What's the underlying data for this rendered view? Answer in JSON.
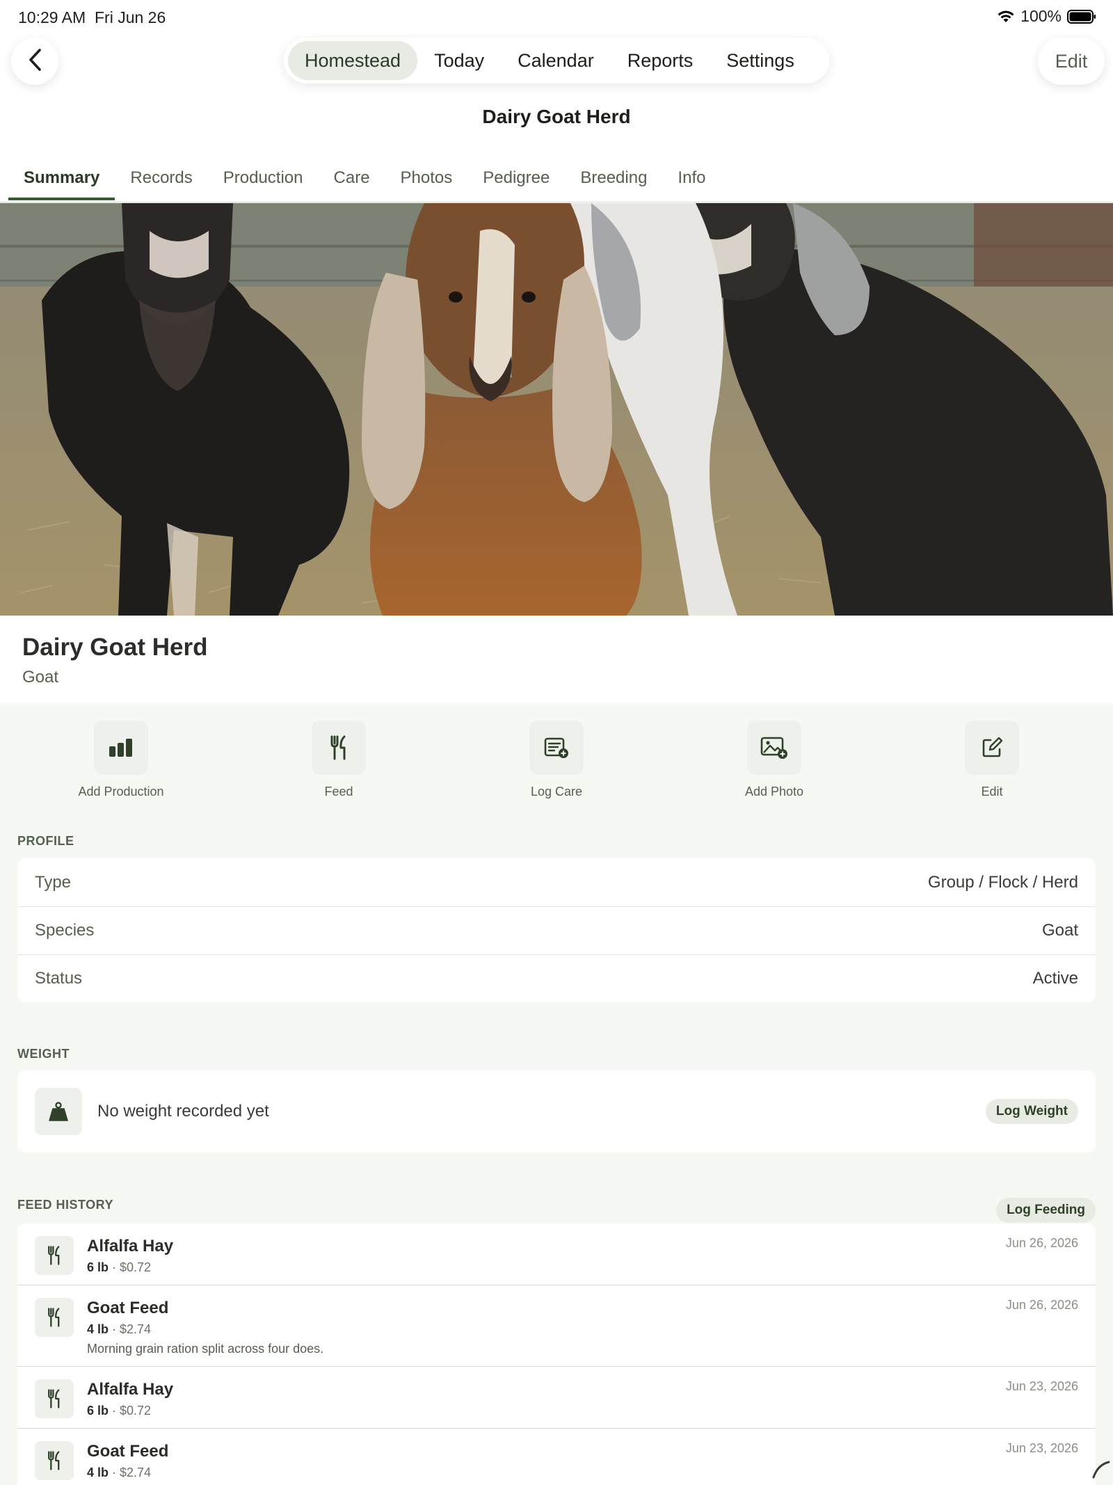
{
  "status_bar": {
    "time": "10:29 AM",
    "date": "Fri Jun 26",
    "battery": "100%",
    "icons": [
      "wifi-icon",
      "battery-icon"
    ]
  },
  "nav": {
    "items": [
      "Homestead",
      "Today",
      "Calendar",
      "Reports",
      "Settings"
    ],
    "active": "Homestead",
    "edit_label": "Edit"
  },
  "page": {
    "title": "Dairy Goat Herd"
  },
  "tabs": {
    "items": [
      "Summary",
      "Records",
      "Production",
      "Care",
      "Photos",
      "Pedigree",
      "Breeding",
      "Info"
    ],
    "active": "Summary"
  },
  "animal": {
    "name": "Dairy Goat Herd",
    "species": "Goat"
  },
  "actions": [
    {
      "label": "Add Production",
      "icon": "bar-chart-icon"
    },
    {
      "label": "Feed",
      "icon": "fork-knife-icon"
    },
    {
      "label": "Log Care",
      "icon": "care-list-icon"
    },
    {
      "label": "Add Photo",
      "icon": "add-photo-icon"
    },
    {
      "label": "Edit",
      "icon": "edit-icon"
    }
  ],
  "profile": {
    "header": "PROFILE",
    "rows": [
      {
        "key": "Type",
        "value": "Group / Flock / Herd"
      },
      {
        "key": "Species",
        "value": "Goat"
      },
      {
        "key": "Status",
        "value": "Active"
      }
    ]
  },
  "weight": {
    "header": "WEIGHT",
    "empty_text": "No weight recorded yet",
    "button": "Log Weight"
  },
  "feed_history": {
    "header": "FEED HISTORY",
    "button": "Log Feeding",
    "entries": [
      {
        "name": "Alfalfa Hay",
        "amount": "6 lb",
        "cost": "· $0.72",
        "date": "Jun 26, 2026",
        "note": ""
      },
      {
        "name": "Goat Feed",
        "amount": "4 lb",
        "cost": "· $2.74",
        "date": "Jun 26, 2026",
        "note": "Morning grain ration split across four does."
      },
      {
        "name": "Alfalfa Hay",
        "amount": "6 lb",
        "cost": "· $0.72",
        "date": "Jun 23, 2026",
        "note": ""
      },
      {
        "name": "Goat Feed",
        "amount": "4 lb",
        "cost": "· $2.74",
        "date": "Jun 23, 2026",
        "note": ""
      }
    ]
  },
  "colors": {
    "accent": "#3b5a34",
    "background": "#f6f8f4",
    "chip": "#e7ebe4"
  }
}
